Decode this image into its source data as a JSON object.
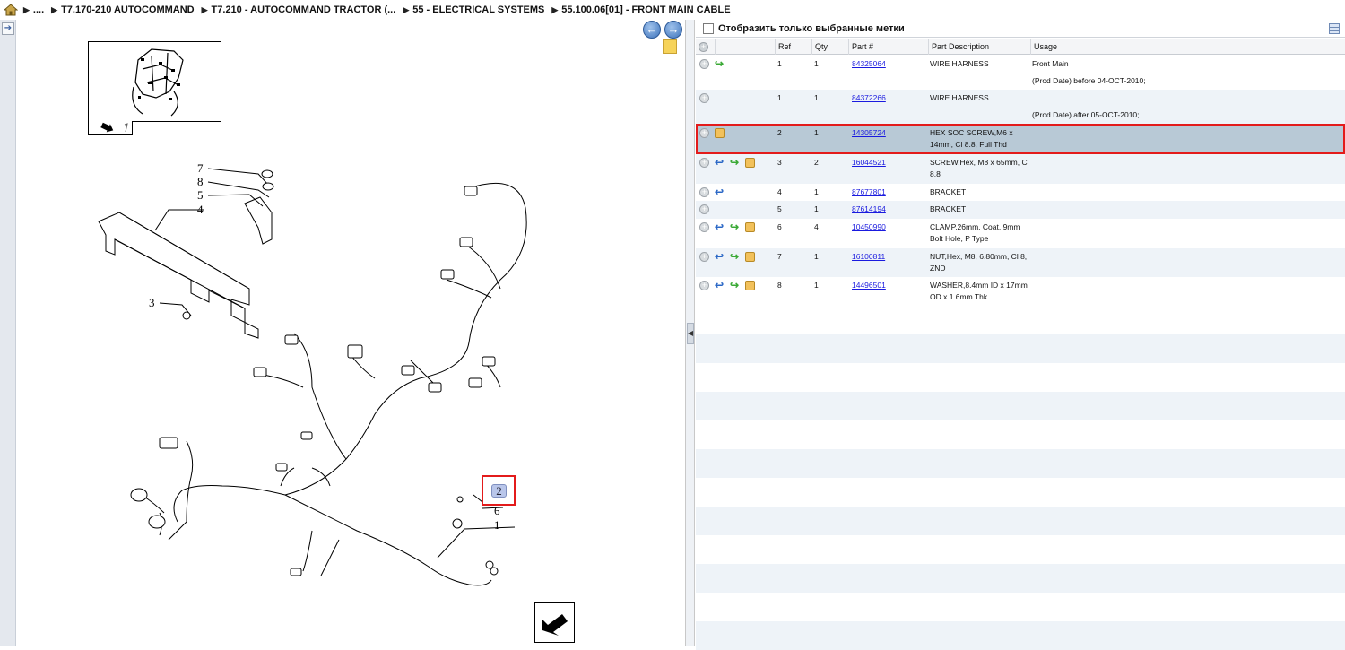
{
  "breadcrumb": {
    "items": [
      {
        "label": "...."
      },
      {
        "label": "T7.170-210 AUTOCOMMAND"
      },
      {
        "label": "T7.210 - AUTOCOMMAND TRACTOR (..."
      },
      {
        "label": "55 - ELECTRICAL SYSTEMS"
      },
      {
        "label": "55.100.06[01] - FRONT MAIN CABLE"
      }
    ]
  },
  "icons": {
    "home": "home-icon",
    "back": "back-arrow-icon",
    "forward": "forward-arrow-icon",
    "note": "note-icon",
    "grid": "grid-icon"
  },
  "diagram": {
    "callouts": [
      "7",
      "8",
      "5",
      "4",
      "3",
      "2",
      "6",
      "1"
    ],
    "selected_callout": "2"
  },
  "filter": {
    "label": "Отобразить только выбранные метки",
    "checked": false
  },
  "table": {
    "headers": {
      "ref": "Ref",
      "qty": "Qty",
      "part": "Part #",
      "desc": "Part Description",
      "usage": "Usage"
    },
    "rows": [
      {
        "icons": [
          "add",
          "green"
        ],
        "ref": "1",
        "qty": "1",
        "part": "84325064",
        "desc": [
          "WIRE HARNESS"
        ],
        "usage": [
          "Front Main",
          "(Prod Date) before 04-OCT-2010;"
        ]
      },
      {
        "icons": [
          "add"
        ],
        "ref": "1",
        "qty": "1",
        "part": "84372266",
        "desc": [
          "WIRE HARNESS"
        ],
        "usage": [
          "",
          "(Prod Date) after 05-OCT-2010;"
        ]
      },
      {
        "icons": [
          "add",
          "box"
        ],
        "ref": "2",
        "qty": "1",
        "part": "14305724",
        "desc": [
          "HEX SOC SCREW,M6 x",
          "14mm, Cl 8.8, Full Thd"
        ],
        "usage": [
          ""
        ],
        "selected": true
      },
      {
        "icons": [
          "add",
          "blue",
          "green",
          "box"
        ],
        "ref": "3",
        "qty": "2",
        "part": "16044521",
        "desc": [
          "SCREW,Hex, M8 x 65mm, Cl",
          "8.8"
        ],
        "usage": [
          ""
        ]
      },
      {
        "icons": [
          "add",
          "blue"
        ],
        "ref": "4",
        "qty": "1",
        "part": "87677801",
        "desc": [
          "BRACKET"
        ],
        "usage": [
          ""
        ]
      },
      {
        "icons": [
          "add"
        ],
        "ref": "5",
        "qty": "1",
        "part": "87614194",
        "desc": [
          "BRACKET"
        ],
        "usage": [
          ""
        ]
      },
      {
        "icons": [
          "add",
          "blue",
          "green",
          "box"
        ],
        "ref": "6",
        "qty": "4",
        "part": "10450990",
        "desc": [
          "CLAMP,26mm, Coat, 9mm",
          "Bolt Hole, P Type"
        ],
        "usage": [
          ""
        ]
      },
      {
        "icons": [
          "add",
          "blue",
          "green",
          "box"
        ],
        "ref": "7",
        "qty": "1",
        "part": "16100811",
        "desc": [
          "NUT,Hex, M8, 6.80mm, Cl 8,",
          "ZND"
        ],
        "usage": [
          ""
        ]
      },
      {
        "icons": [
          "add",
          "blue",
          "green",
          "box"
        ],
        "ref": "8",
        "qty": "1",
        "part": "14496501",
        "desc": [
          "WASHER,8.4mm ID x 17mm",
          "OD x 1.6mm Thk"
        ],
        "usage": [
          ""
        ]
      }
    ]
  }
}
